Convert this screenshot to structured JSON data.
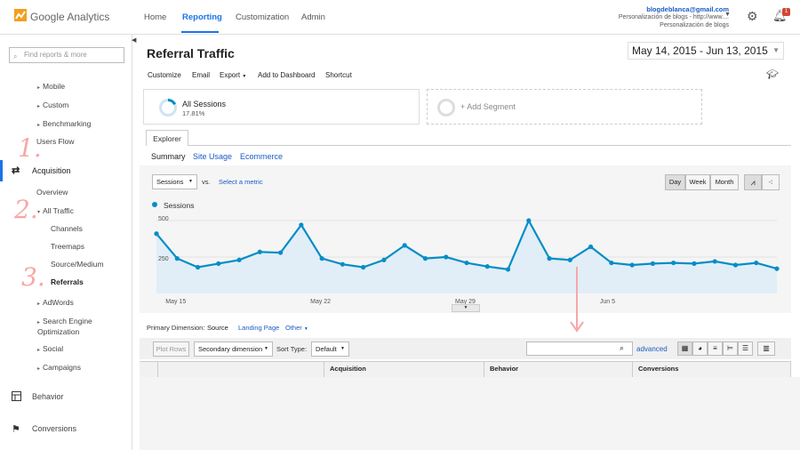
{
  "header": {
    "logo": "Google Analytics",
    "nav": [
      "Home",
      "Reporting",
      "Customization",
      "Admin"
    ],
    "account_email": "blogdeblanca@gmail.com",
    "account_property": "Personalización de blogs - http://www....",
    "account_view": "Personalización de blogs",
    "notifications": "1"
  },
  "sidebar": {
    "search_placeholder": "Find reports & more",
    "items": {
      "mobile": "Mobile",
      "custom": "Custom",
      "benchmarking": "Benchmarking",
      "users_flow": "Users Flow",
      "acquisition": "Acquisition",
      "overview": "Overview",
      "all_traffic": "All Traffic",
      "channels": "Channels",
      "treemaps": "Treemaps",
      "source_medium": "Source/Medium",
      "referrals": "Referrals",
      "adwords": "AdWords",
      "seo": "Search Engine Optimization",
      "social": "Social",
      "campaigns": "Campaigns",
      "behavior": "Behavior",
      "conversions": "Conversions"
    },
    "annotations": [
      "1.",
      "2.",
      "3."
    ]
  },
  "report": {
    "title": "Referral Traffic",
    "date_range": "May 14, 2015 - Jun 13, 2015",
    "toolbar": [
      "Customize",
      "Email",
      "Export",
      "Add to Dashboard",
      "Shortcut"
    ],
    "segment_name": "All Sessions",
    "segment_pct": "17.81%",
    "add_segment": "+ Add Segment",
    "tab": "Explorer",
    "subtabs": [
      "Summary",
      "Site Usage",
      "Ecommerce"
    ],
    "metric": "Sessions",
    "vs": "vs.",
    "select_metric": "Select a metric",
    "range_buttons": [
      "Day",
      "Week",
      "Month"
    ],
    "primary_dimension_label": "Primary Dimension:",
    "dim_source": "Source",
    "dim_landing": "Landing Page",
    "dim_other": "Other",
    "plot_rows": "Plot Rows",
    "secondary_dimension": "Secondary dimension",
    "sort_type_label": "Sort Type:",
    "sort_type": "Default",
    "advanced": "advanced",
    "table_headers": [
      "Acquisition",
      "Behavior",
      "Conversions"
    ]
  },
  "chart_data": {
    "type": "area",
    "legend": "Sessions",
    "ylim": [
      0,
      500
    ],
    "yticks": [
      "500",
      "250"
    ],
    "xticks": [
      {
        "label": "May 15",
        "index": 1
      },
      {
        "label": "May 22",
        "index": 8
      },
      {
        "label": "May 29",
        "index": 15
      },
      {
        "label": "Jun 5",
        "index": 22
      }
    ],
    "values": [
      410,
      240,
      180,
      205,
      230,
      285,
      280,
      470,
      240,
      200,
      180,
      230,
      330,
      240,
      250,
      210,
      185,
      165,
      500,
      240,
      230,
      320,
      210,
      195,
      205,
      210,
      205,
      220,
      195,
      210,
      170
    ]
  },
  "colors": {
    "line": "#058dc7",
    "fill": "#e1eef7",
    "accent": "#1a5bc4",
    "annotation": "#f7a7a7"
  }
}
